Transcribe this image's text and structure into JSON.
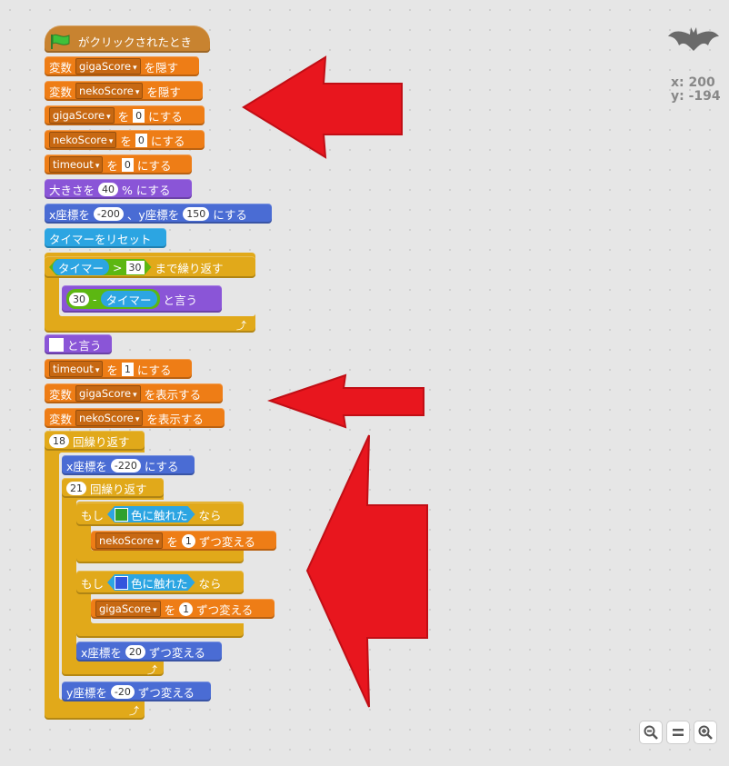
{
  "script": {
    "hat": {
      "label": "がクリックされたとき"
    },
    "hide_giga": {
      "prefix": "変数",
      "var": "gigaScore",
      "suffix": "を隠す"
    },
    "hide_neko": {
      "prefix": "変数",
      "var": "nekoScore",
      "suffix": "を隠す"
    },
    "set_giga": {
      "var": "gigaScore",
      "to": "を",
      "value": "0",
      "suffix": "にする"
    },
    "set_neko": {
      "var": "nekoScore",
      "to": "を",
      "value": "0",
      "suffix": "にする"
    },
    "set_timeout0": {
      "var": "timeout",
      "to": "を",
      "value": "0",
      "suffix": "にする"
    },
    "size": {
      "prefix": "大きさを",
      "value": "40",
      "suffix": "% にする"
    },
    "goto": {
      "x_label": "x座標を",
      "x": "-200",
      "sep": "、y座標を",
      "y": "150",
      "suffix": "にする"
    },
    "reset_timer": {
      "label": "タイマーをリセット"
    },
    "repeat_until": {
      "timer": "タイマー",
      "op": ">",
      "value": "30",
      "suffix": "まで繰り返す"
    },
    "say_loop": {
      "value": "30",
      "minus": "-",
      "timer": "タイマー",
      "suffix": "と言う"
    },
    "say_empty": {
      "suffix": "と言う"
    },
    "set_timeout1": {
      "var": "timeout",
      "to": "を",
      "value": "1",
      "suffix": "にする"
    },
    "show_giga": {
      "prefix": "変数",
      "var": "gigaScore",
      "suffix": "を表示する"
    },
    "show_neko": {
      "prefix": "変数",
      "var": "nekoScore",
      "suffix": "を表示する"
    },
    "repeat18": {
      "value": "18",
      "suffix": "回繰り返す"
    },
    "set_x": {
      "prefix": "x座標を",
      "value": "-220",
      "suffix": "にする"
    },
    "repeat21": {
      "value": "21",
      "suffix": "回繰り返す"
    },
    "if_green": {
      "if": "もし",
      "touch": "色に触れた",
      "then": "なら"
    },
    "change_neko": {
      "var": "nekoScore",
      "to": "を",
      "value": "1",
      "suffix": "ずつ変える"
    },
    "if_blue": {
      "if": "もし",
      "touch": "色に触れた",
      "then": "なら"
    },
    "change_giga": {
      "var": "gigaScore",
      "to": "を",
      "value": "1",
      "suffix": "ずつ変える"
    },
    "change_x": {
      "prefix": "x座標を",
      "value": "20",
      "suffix": "ずつ変える"
    },
    "change_y": {
      "prefix": "y座標を",
      "value": "-20",
      "suffix": "ずつ変える"
    }
  },
  "sprite_info": {
    "x_label": "x:",
    "x_value": "200",
    "y_label": "y:",
    "y_value": "-194"
  },
  "icons": {
    "flag": "green-flag-icon",
    "sprite": "bat-sprite-icon",
    "zoom_out": "zoom-out-icon",
    "zoom_reset": "zoom-reset-icon",
    "zoom_in": "zoom-in-icon",
    "arrow": "red-arrow-annotation"
  },
  "colors": {
    "events": "#c88330",
    "data": "#ee7d16",
    "looks": "#8a55d7",
    "motion": "#4a6cd4",
    "sensing": "#2ca5e2",
    "control": "#e1a91a",
    "operators": "#5cb712",
    "touch_green": "#2fa12f",
    "touch_blue": "#3355dd",
    "annotation": "#e8161e"
  }
}
